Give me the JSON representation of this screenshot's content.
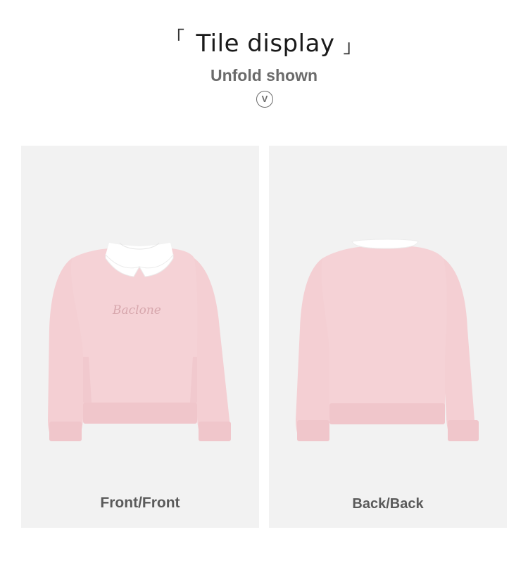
{
  "header": {
    "bracket_left": "「",
    "title": "Tile display",
    "bracket_right": "」",
    "subtitle": "Unfold shown",
    "indicator": "V"
  },
  "panels": [
    {
      "caption": "Front/Front",
      "brand_text": "Baclone"
    },
    {
      "caption": "Back/Back"
    }
  ],
  "colors": {
    "sweater_pink": "#f4cfd3",
    "sweater_shadow": "#e9bcc1",
    "collar": "#ffffff",
    "panel_bg": "#f2f2f2"
  }
}
